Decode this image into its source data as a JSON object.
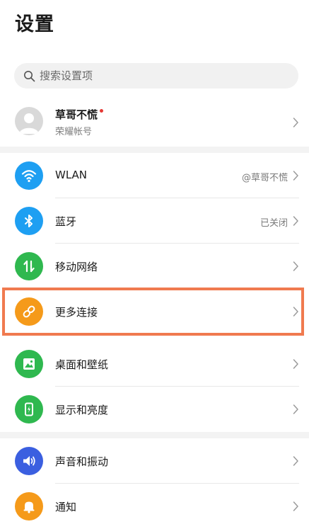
{
  "header": {
    "title": "设置"
  },
  "search": {
    "placeholder": "搜索设置项"
  },
  "account": {
    "name": "草哥不慌",
    "subtitle": "荣耀帐号"
  },
  "settings": [
    {
      "label": "WLAN",
      "value": "@草哥不慌",
      "icon": "wifi-icon",
      "color": "#1e9ff2"
    },
    {
      "label": "蓝牙",
      "value": "已关闭",
      "icon": "bluetooth-icon",
      "color": "#1e9ff2"
    },
    {
      "label": "移动网络",
      "value": "",
      "icon": "mobile-data-icon",
      "color": "#2fb84f"
    },
    {
      "label": "更多连接",
      "value": "",
      "icon": "link-icon",
      "color": "#f59a1a"
    },
    {
      "label": "桌面和壁纸",
      "value": "",
      "icon": "wallpaper-icon",
      "color": "#2fb84f"
    },
    {
      "label": "显示和亮度",
      "value": "",
      "icon": "display-icon",
      "color": "#2fb84f"
    },
    {
      "label": "声音和振动",
      "value": "",
      "icon": "sound-icon",
      "color": "#3b5fe0"
    },
    {
      "label": "通知",
      "value": "",
      "icon": "notification-bell-icon",
      "color": "#f59a1a"
    }
  ],
  "colors": {
    "highlight": "#f07a4f",
    "account_dot": "#e53935"
  }
}
